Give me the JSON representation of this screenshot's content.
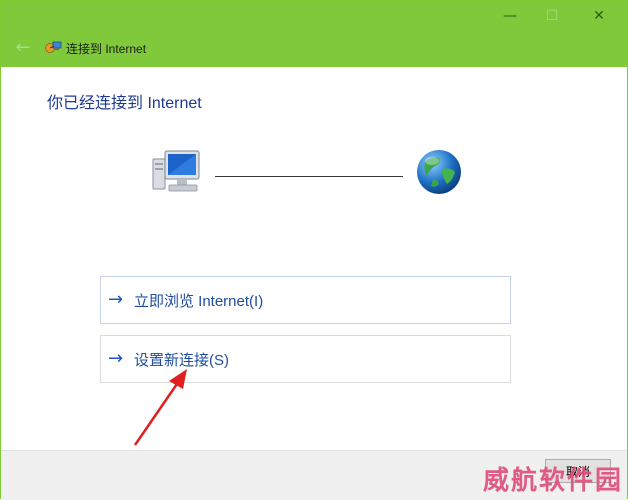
{
  "window": {
    "title": "连接到 Internet",
    "controls": {
      "minimize": "—",
      "maximize": "☐",
      "close": "✕"
    },
    "back_glyph": "←"
  },
  "main": {
    "heading": "你已经连接到 Internet",
    "options": [
      {
        "arrow": "→",
        "label": "立即浏览 Internet(I)"
      },
      {
        "arrow": "→",
        "label": "设置新连接(S)"
      }
    ]
  },
  "footer": {
    "cancel_label": "取消"
  },
  "watermark": "威航软件园",
  "icons": {
    "title": "network-connection-icon",
    "computer": "computer-icon",
    "globe": "globe-icon"
  },
  "colors": {
    "titlebar": "#80c93b",
    "heading": "#1f3a93",
    "link": "#1f4d9e",
    "annotation_arrow": "#e02020",
    "watermark": "#e04c7a"
  }
}
